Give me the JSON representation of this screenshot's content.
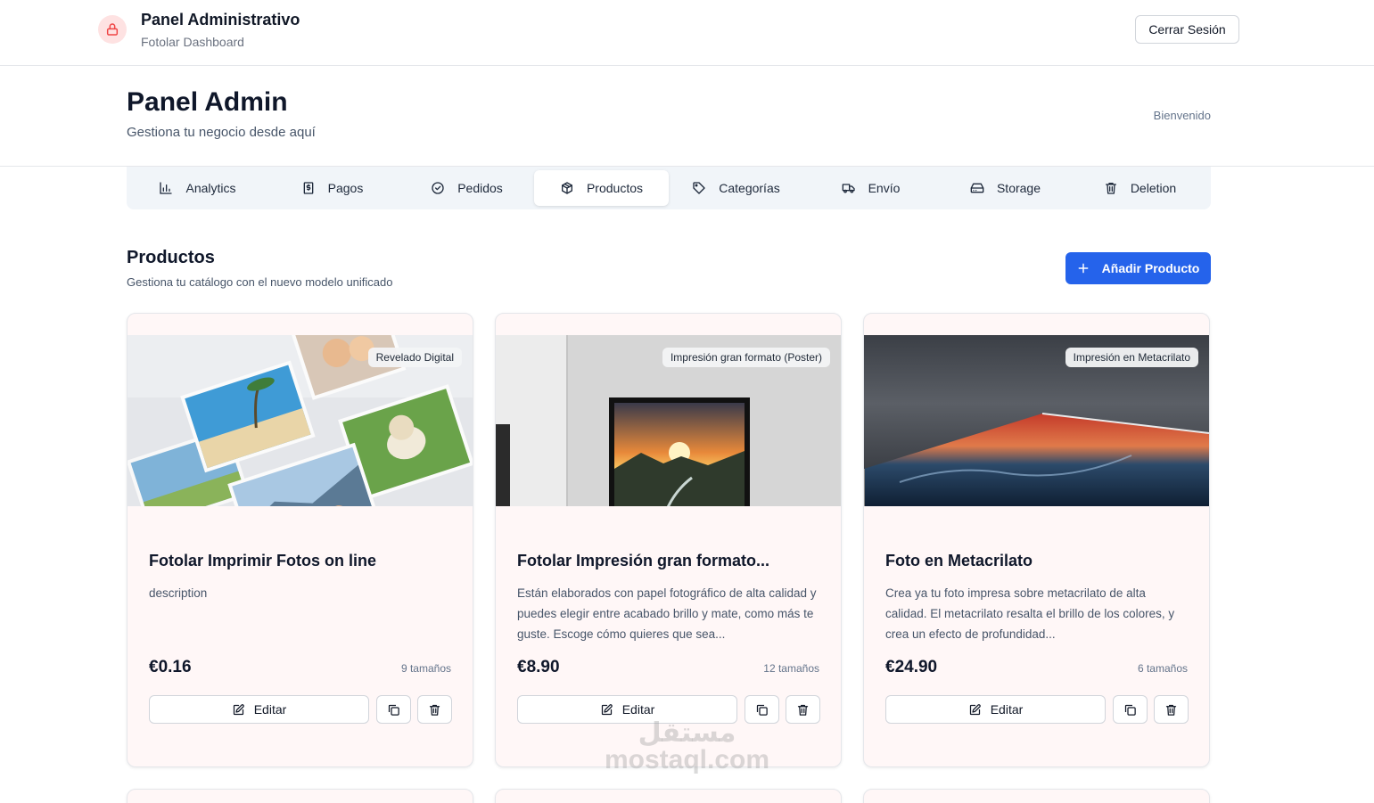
{
  "header": {
    "title": "Panel Administrativo",
    "subtitle": "Fotolar Dashboard",
    "logout_label": "Cerrar Sesión",
    "brand_icon": "lock-icon",
    "accent": "#ef4444"
  },
  "page": {
    "title": "Panel Admin",
    "subtitle": "Gestiona tu negocio desde aquí",
    "welcome": "Bienvenido"
  },
  "tabs": [
    {
      "label": "Analytics",
      "icon": "bar-chart-icon",
      "active": false
    },
    {
      "label": "Pagos",
      "icon": "receipt-icon",
      "active": false
    },
    {
      "label": "Pedidos",
      "icon": "check-circle-icon",
      "active": false
    },
    {
      "label": "Productos",
      "icon": "package-icon",
      "active": true
    },
    {
      "label": "Categorías",
      "icon": "tag-icon",
      "active": false
    },
    {
      "label": "Envío",
      "icon": "truck-icon",
      "active": false
    },
    {
      "label": "Storage",
      "icon": "hard-drive-icon",
      "active": false
    },
    {
      "label": "Deletion",
      "icon": "trash-icon",
      "active": false
    }
  ],
  "section": {
    "title": "Productos",
    "subtitle": "Gestiona tu catálogo con el nuevo modelo unificado",
    "add_label": "Añadir Producto",
    "add_color": "#2563eb"
  },
  "products": [
    {
      "badge": "Revelado Digital",
      "title": "Fotolar Imprimir Fotos on line",
      "description": "description",
      "price": "€0.16",
      "sizes": "9 tamaños",
      "edit_label": "Editar"
    },
    {
      "badge": "Impresión gran formato (Poster)",
      "title": "Fotolar Impresión gran formato...",
      "description": "Están elaborados con papel fotográfico de alta calidad y puedes elegir entre acabado brillo y mate, como más te guste. Escoge cómo quieres que sea...",
      "price": "€8.90",
      "sizes": "12 tamaños",
      "edit_label": "Editar"
    },
    {
      "badge": "Impresión en Metacrilato",
      "title": "Foto en Metacrilato",
      "description": "Crea ya tu foto impresa sobre metacrilato de alta calidad. El metacrilato resalta el brillo de los colores, y crea un efecto de profundidad...",
      "price": "€24.90",
      "sizes": "6 tamaños",
      "edit_label": "Editar"
    }
  ],
  "watermark": {
    "arabic": "مستقل",
    "latin": "mostaql.com"
  }
}
